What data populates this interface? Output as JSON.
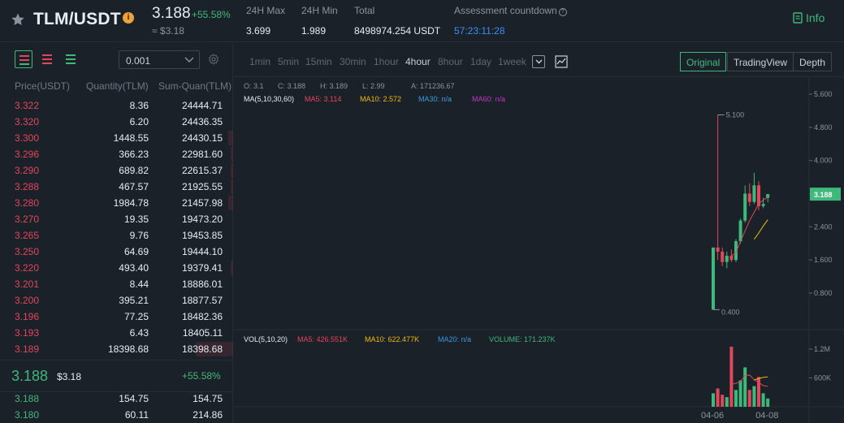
{
  "header": {
    "pair": "TLM/USDT",
    "info_badge": "i",
    "price": "3.188",
    "change": "+55.58%",
    "approx_usd": "≈ $3.18",
    "stats": [
      {
        "label": "24H Max",
        "value": "3.699"
      },
      {
        "label": "24H Min",
        "value": "1.989"
      },
      {
        "label": "Total",
        "value": "8498974.254 USDT"
      },
      {
        "label": "Assessment countdown",
        "value": "57:23:11:28"
      }
    ],
    "info_button": "Info"
  },
  "orderbook": {
    "precision": "0.001",
    "headers": {
      "price": "Price(USDT)",
      "qty": "Quantity(TLM)",
      "sum": "Sum-Quan(TLM)"
    },
    "asks": [
      {
        "price": "3.322",
        "qty": "8.36",
        "sum": "24444.71",
        "depth": 0
      },
      {
        "price": "3.320",
        "qty": "6.20",
        "sum": "24436.35",
        "depth": 0
      },
      {
        "price": "3.300",
        "qty": "1448.55",
        "sum": "24430.15",
        "depth": 0.02
      },
      {
        "price": "3.296",
        "qty": "366.23",
        "sum": "22981.60",
        "depth": 0.01
      },
      {
        "price": "3.290",
        "qty": "689.82",
        "sum": "22615.37",
        "depth": 0.01
      },
      {
        "price": "3.288",
        "qty": "467.57",
        "sum": "21925.55",
        "depth": 0.01
      },
      {
        "price": "3.280",
        "qty": "1984.78",
        "sum": "21457.98",
        "depth": 0.02
      },
      {
        "price": "3.270",
        "qty": "19.35",
        "sum": "19473.20",
        "depth": 0
      },
      {
        "price": "3.265",
        "qty": "9.76",
        "sum": "19453.85",
        "depth": 0
      },
      {
        "price": "3.250",
        "qty": "64.69",
        "sum": "19444.10",
        "depth": 0
      },
      {
        "price": "3.220",
        "qty": "493.40",
        "sum": "19379.41",
        "depth": 0.01
      },
      {
        "price": "3.201",
        "qty": "8.44",
        "sum": "18886.01",
        "depth": 0
      },
      {
        "price": "3.200",
        "qty": "395.21",
        "sum": "18877.57",
        "depth": 0
      },
      {
        "price": "3.196",
        "qty": "77.25",
        "sum": "18482.36",
        "depth": 0
      },
      {
        "price": "3.193",
        "qty": "6.43",
        "sum": "18405.11",
        "depth": 0
      },
      {
        "price": "3.189",
        "qty": "18398.68",
        "sum": "18398.68",
        "depth": 0.16
      }
    ],
    "mid": {
      "price": "3.188",
      "usd": "$3.18",
      "change": "+55.58%"
    },
    "bids": [
      {
        "price": "3.188",
        "qty": "154.75",
        "sum": "154.75",
        "depth": 0
      },
      {
        "price": "3.180",
        "qty": "60.11",
        "sum": "214.86",
        "depth": 0
      }
    ]
  },
  "toolbar": {
    "timeframes": [
      "1min",
      "5min",
      "15min",
      "30min",
      "1hour",
      "4hour",
      "8hour",
      "1day",
      "1week"
    ],
    "active_timeframe": "4hour",
    "modes": [
      "Original",
      "TradingView",
      "Depth"
    ],
    "active_mode": "Original"
  },
  "chart_data": {
    "type": "candlestick",
    "ohlc_legend": {
      "O": "O: 3.1",
      "C": "C: 3.188",
      "H": "H: 3.189",
      "L": "L: 2.99",
      "A": "A: 171236.67"
    },
    "ma_legend": {
      "label": "MA(5,10,30,60)",
      "ma5": "MA5: 3.114",
      "ma10": "MA10: 2.572",
      "ma30": "MA30: n/a",
      "ma60": "MA60: n/a"
    },
    "vol_legend": {
      "label": "VOL(5,10,20)",
      "ma5": "MA5: 426.551K",
      "ma10": "MA10: 622.477K",
      "ma20": "MA20: n/a",
      "volume": "VOLUME: 171.237K"
    },
    "price_ticks": [
      "5.600",
      "4.800",
      "4.000",
      "3.200",
      "2.400",
      "1.600",
      "0.800"
    ],
    "price_tick_values": [
      5.6,
      4.8,
      4.0,
      3.2,
      2.4,
      1.6,
      0.8
    ],
    "vol_ticks": [
      "1.2M",
      "600K"
    ],
    "vol_tick_values": [
      1200000,
      600000
    ],
    "x_ticks": [
      "04-06",
      "04-08"
    ],
    "x_tick_index": [
      0,
      12
    ],
    "current_price_label": "3.188",
    "current_price": 3.188,
    "high_marker": "5.100",
    "low_marker": "0.400",
    "candles": [
      {
        "o": 0.4,
        "h": 1.9,
        "l": 0.4,
        "c": 1.9,
        "v": 280000
      },
      {
        "o": 1.9,
        "h": 5.1,
        "l": 1.6,
        "c": 1.8,
        "v": 380000
      },
      {
        "o": 1.8,
        "h": 1.9,
        "l": 1.45,
        "c": 1.55,
        "v": 250000
      },
      {
        "o": 1.55,
        "h": 1.8,
        "l": 1.4,
        "c": 1.7,
        "v": 200000
      },
      {
        "o": 1.7,
        "h": 1.85,
        "l": 1.55,
        "c": 1.6,
        "v": 1250000
      },
      {
        "o": 1.6,
        "h": 2.1,
        "l": 1.55,
        "c": 2.05,
        "v": 350000
      },
      {
        "o": 2.05,
        "h": 2.6,
        "l": 2.0,
        "c": 2.55,
        "v": 550000
      },
      {
        "o": 2.55,
        "h": 3.4,
        "l": 2.5,
        "c": 3.2,
        "v": 820000
      },
      {
        "o": 3.2,
        "h": 3.45,
        "l": 2.9,
        "c": 3.0,
        "v": 350000
      },
      {
        "o": 3.0,
        "h": 3.7,
        "l": 2.95,
        "c": 3.4,
        "v": 430000
      },
      {
        "o": 3.4,
        "h": 3.5,
        "l": 2.8,
        "c": 2.9,
        "v": 620000
      },
      {
        "o": 2.9,
        "h": 3.1,
        "l": 2.85,
        "c": 2.95,
        "v": 280000
      },
      {
        "o": 3.1,
        "h": 3.189,
        "l": 2.99,
        "c": 3.188,
        "v": 171237
      }
    ],
    "ma5_line": [
      null,
      null,
      null,
      null,
      1.7,
      1.78,
      2.05,
      2.3,
      2.55,
      2.75,
      2.95,
      3.05,
      3.114
    ],
    "ma10_line": [
      null,
      null,
      null,
      null,
      null,
      null,
      null,
      null,
      null,
      2.1,
      2.25,
      2.42,
      2.572
    ],
    "vol_ma5_line": [
      null,
      null,
      null,
      null,
      470000,
      490000,
      520000,
      650000,
      660000,
      560000,
      510000,
      440000,
      426551
    ],
    "vol_ma10_line": [
      null,
      null,
      null,
      null,
      null,
      null,
      null,
      null,
      null,
      560000,
      590000,
      610000,
      622477
    ]
  }
}
